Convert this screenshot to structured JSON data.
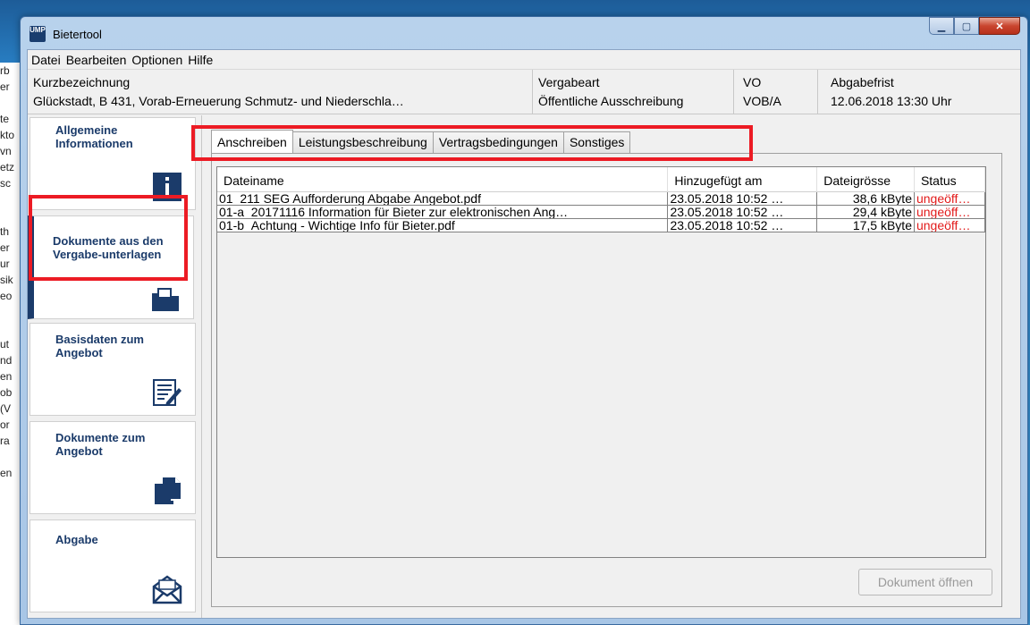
{
  "window": {
    "title": "Bietertool",
    "icon_text": "UMP"
  },
  "menu": [
    "Datei",
    "Bearbeiten",
    "Optionen",
    "Hilfe"
  ],
  "info": {
    "kurz_label": "Kurzbezeichnung",
    "kurz_value": "Glückstadt, B 431, Vorab-Erneuerung Schmutz- und Niederschla…",
    "vergabeart_label": "Vergabeart",
    "vergabeart_value": "Öffentliche Ausschreibung",
    "vo_label": "VO",
    "vo_value": "VOB/A",
    "frist_label": "Abgabefrist",
    "frist_value": "12.06.2018 13:30 Uhr"
  },
  "nav": {
    "allgemein": "Allgemeine Informationen",
    "dokumente_vergabe": "Dokumente aus den Vergabe-unterlagen",
    "basisdaten": "Basisdaten zum Angebot",
    "dokumente_angebot": "Dokumente zum Angebot",
    "abgabe": "Abgabe"
  },
  "tabs": [
    "Anschreiben",
    "Leistungsbeschreibung",
    "Vertragsbedingungen",
    "Sonstiges"
  ],
  "table": {
    "headers": [
      "Dateiname",
      "Hinzugefügt am",
      "Dateigrösse",
      "Status"
    ],
    "rows": [
      [
        "01_211 SEG Aufforderung Abgabe Angebot.pdf",
        "23.05.2018 10:52 …",
        "38,6 kByte",
        "ungeöff…"
      ],
      [
        "01-a_20171116 Information für Bieter zur elektronischen Ang…",
        "23.05.2018 10:52 …",
        "29,4 kByte",
        "ungeöff…"
      ],
      [
        "01-b_Achtung - Wichtige Info für Bieter.pdf",
        "23.05.2018 10:52 …",
        "17,5 kByte",
        "ungeöff…"
      ]
    ]
  },
  "buttons": {
    "open": "Dokument öffnen"
  },
  "colors": {
    "status": "#e21b1b",
    "nav_text": "#1b3b6a",
    "highlight": "#ec1b24"
  }
}
